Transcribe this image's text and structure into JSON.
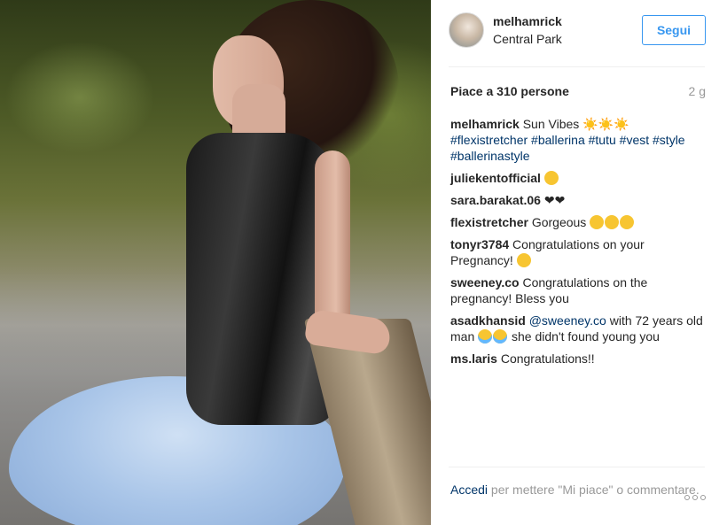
{
  "post": {
    "username": "melhamrick",
    "location": "Central Park",
    "follow_label": "Segui",
    "likes": "Piace a 310 persone",
    "time_ago": "2 g"
  },
  "caption": {
    "user": "melhamrick",
    "text": "Sun Vibes",
    "sun_emojis": "☀️☀️☀️",
    "hashtags": "#flexistretcher #ballerina #tutu #vest #style #ballerinastyle"
  },
  "comments": [
    {
      "user": "juliekentofficial",
      "text": ""
    },
    {
      "user": "sara.barakat.06",
      "text": "❤❤"
    },
    {
      "user": "flexistretcher",
      "text": "Gorgeous"
    },
    {
      "user": "tonyr3784",
      "text": "Congratulations on your Pregnancy!"
    },
    {
      "user": "sweeney.co",
      "text": "Congratulations on the pregnancy! Bless you"
    },
    {
      "user": "asadkhansid",
      "mention": "@sweeney.co",
      "text": "with 72 years old man",
      "text2": "she didn't found young you"
    },
    {
      "user": "ms.laris",
      "text": "Congratulations!!"
    }
  ],
  "footer": {
    "login_label": "Accedi",
    "rest": "per mettere \"Mi piace\" o commentare."
  },
  "icons": {
    "more": "more-options-icon",
    "sun": "sun-emoji-icon",
    "heart_eyes": "heart-eyes-emoji-icon",
    "smile": "smile-emoji-icon",
    "tears_of_joy": "tears-of-joy-emoji-icon"
  },
  "colors": {
    "link": "#003569",
    "accent": "#3897f0",
    "muted": "#999999",
    "text": "#262626"
  }
}
